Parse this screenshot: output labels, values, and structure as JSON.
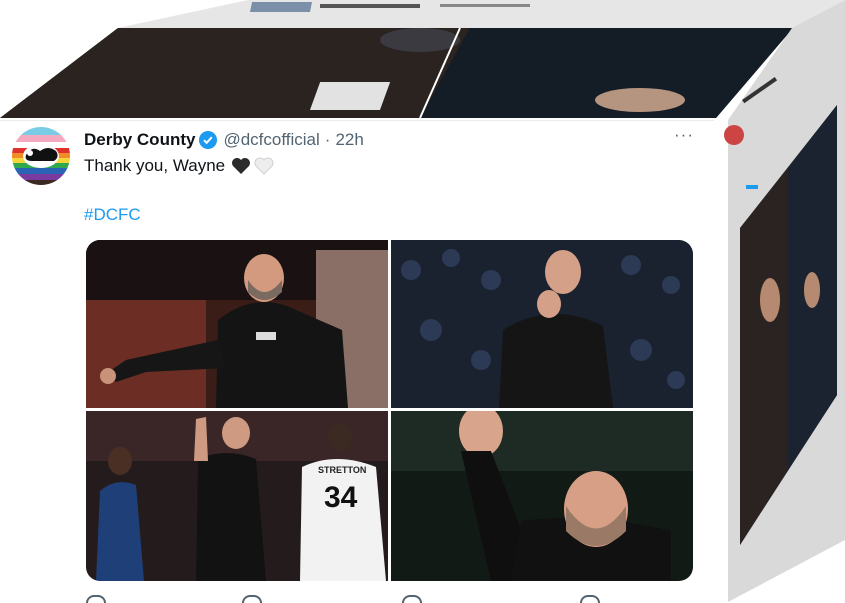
{
  "tweet": {
    "display_name": "Derby County",
    "handle": "@dcfcofficial",
    "separator": "·",
    "time": "22h",
    "more_label": "···",
    "text": "Thank you, Wayne",
    "hashtag": "#DCFC"
  },
  "photo_text": {
    "shirt_name": "STRETTON",
    "shirt_number": "34"
  },
  "colors": {
    "name": "#0f1419",
    "secondary": "#536471",
    "link": "#1d9bf0",
    "verified": "#1d9bf0"
  },
  "icons": [
    "rainbow-ram-logo",
    "verified-badge-icon",
    "black-heart-icon",
    "white-heart-icon",
    "more-options-icon"
  ]
}
